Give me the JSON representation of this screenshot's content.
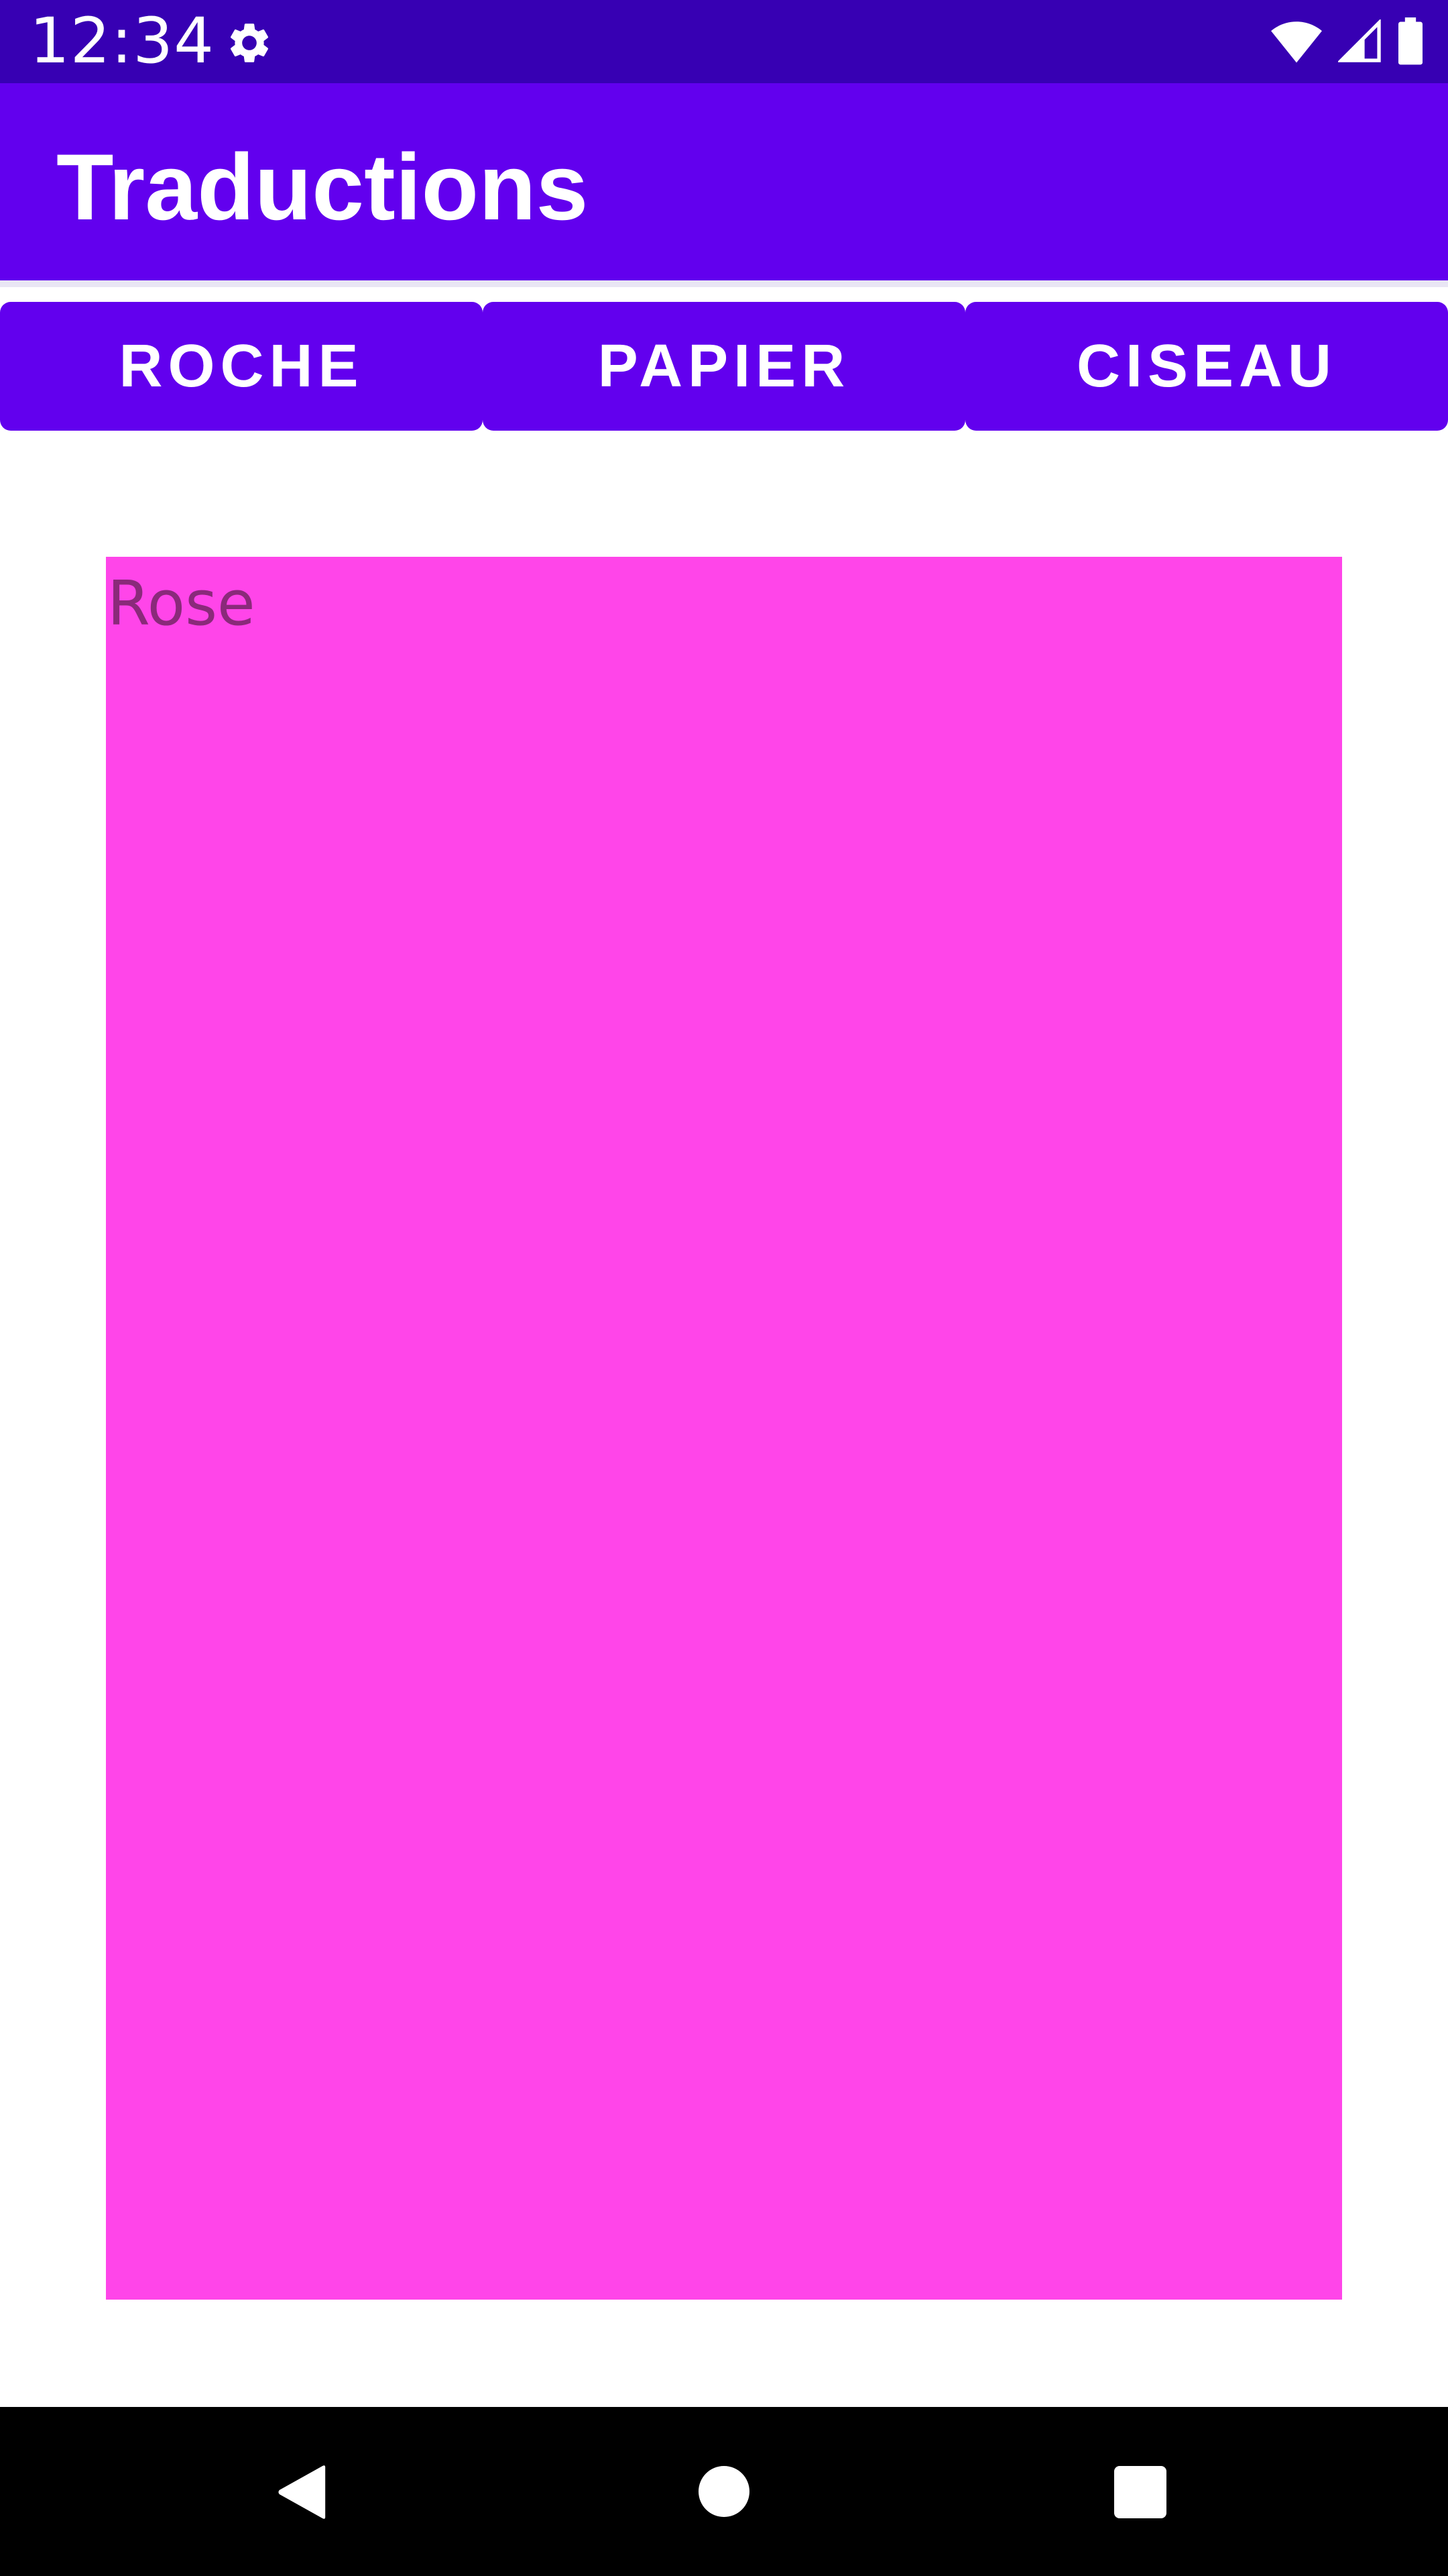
{
  "status_bar": {
    "time": "12:34",
    "icons": [
      "settings-icon",
      "wifi-icon",
      "signal-icon",
      "battery-icon"
    ],
    "background_color": "#3700B3"
  },
  "app_bar": {
    "title": "Traductions",
    "background_color": "#6200EE"
  },
  "buttons": [
    {
      "label": "ROCHE"
    },
    {
      "label": "PAPIER"
    },
    {
      "label": "CISEAU"
    }
  ],
  "color_panel": {
    "label": "Rose",
    "color": "#FF45E9"
  },
  "nav_bar": {
    "icons": [
      "back-icon",
      "home-icon",
      "recents-icon"
    ]
  }
}
